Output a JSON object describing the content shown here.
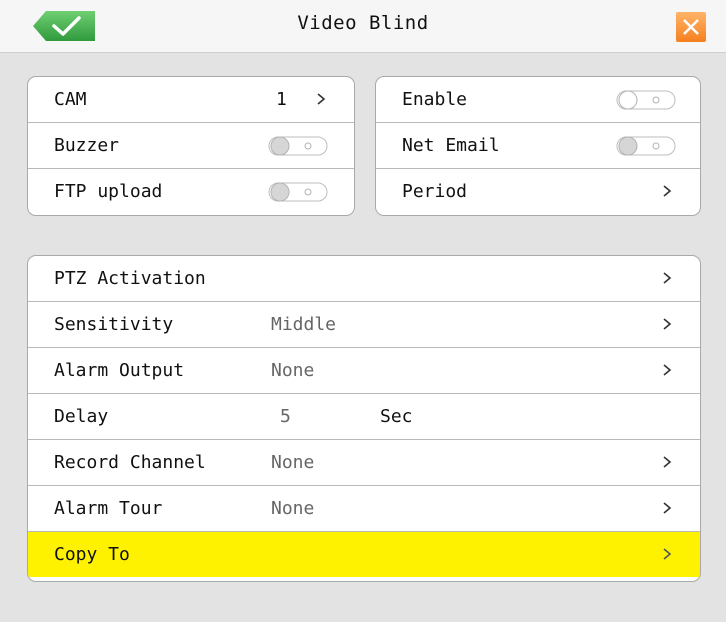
{
  "window": {
    "title": "Video Blind"
  },
  "icons": {
    "ok": "check-icon",
    "close": "close-icon",
    "chevron": "chevron-right-icon"
  },
  "colors": {
    "highlight": "#fff200",
    "close": "#f5801e",
    "ok": "#3fa44a"
  },
  "left_panel": [
    {
      "label": "CAM",
      "value": "1",
      "control": "chevron"
    },
    {
      "label": "Buzzer",
      "control": "toggle"
    },
    {
      "label": "FTP upload",
      "control": "toggle"
    }
  ],
  "right_panel": [
    {
      "label": "Enable",
      "control": "toggle"
    },
    {
      "label": "Net Email",
      "control": "toggle"
    },
    {
      "label": "Period",
      "control": "chevron"
    }
  ],
  "settings": [
    {
      "label": "PTZ Activation",
      "value": "",
      "chevron": true
    },
    {
      "label": "Sensitivity",
      "value": "Middle",
      "chevron": true
    },
    {
      "label": "Alarm Output",
      "value": "None",
      "chevron": true
    },
    {
      "label": "Delay",
      "value": "5",
      "unit": "Sec",
      "chevron": false
    },
    {
      "label": "Record Channel",
      "value": "None",
      "chevron": true
    },
    {
      "label": "Alarm Tour",
      "value": "None",
      "chevron": true
    },
    {
      "label": "Copy To",
      "value": "",
      "chevron": true,
      "selected": true
    }
  ]
}
